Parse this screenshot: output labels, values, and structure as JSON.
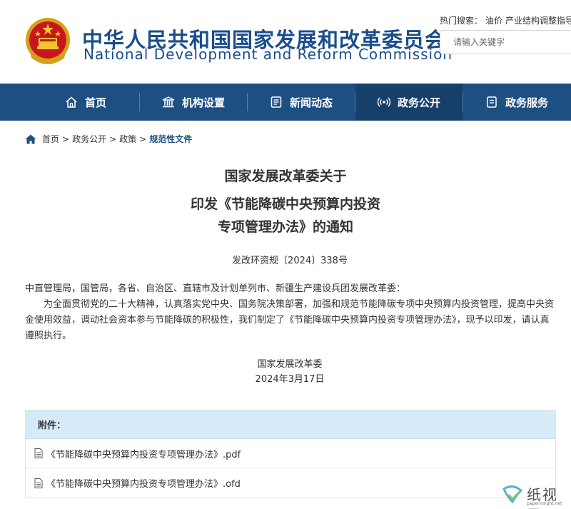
{
  "header": {
    "title_cn": "中华人民共和国国家发展和改革委员会",
    "title_en": "National Development and Reform Commission",
    "hot_search_label": "热门搜索：",
    "hot_search_items": [
      "油价",
      "产业结构调整指导"
    ],
    "search_placeholder": "请输入关键字"
  },
  "nav": {
    "items": [
      {
        "label": "首页",
        "icon": "home-icon"
      },
      {
        "label": "机构设置",
        "icon": "institution-icon"
      },
      {
        "label": "新闻动态",
        "icon": "news-icon"
      },
      {
        "label": "政务公开",
        "icon": "broadcast-icon",
        "active": true
      },
      {
        "label": "政务服务",
        "icon": "service-icon"
      }
    ]
  },
  "breadcrumb": {
    "items": [
      "首页",
      "政务公开",
      "政策"
    ],
    "separator": ">",
    "current": "规范性文件"
  },
  "article": {
    "title_lines": [
      "国家发展改革委关于",
      "印发《节能降碳中央预算内投资",
      "专项管理办法》的通知"
    ],
    "doc_number": "发改环资规〔2024〕338号",
    "recipients": "中直管理局，国管局，各省、自治区、直辖市及计划单列市、新疆生产建设兵团发展改革委：",
    "body": "为全面贯彻党的二十大精神，认真落实党中央、国务院决策部署，加强和规范节能降碳专项中央预算内投资管理，提高中央资金使用效益，调动社会资本参与节能降碳的积极性，我们制定了《节能降碳中央预算内投资专项管理办法》，现予以印发，请认真遵照执行。",
    "signature_org": "国家发展改革委",
    "signature_date": "2024年3月17日"
  },
  "attachments": {
    "header": "附件：",
    "files": [
      "《节能降碳中央预算内投资专项管理办法》.pdf",
      "《节能降碳中央预算内投资专项管理办法》.ofd"
    ]
  },
  "watermark": {
    "text": "纸视界",
    "sub": "paperinsight.net"
  },
  "colors": {
    "brand_blue": "#1d4f83",
    "nav_active": "#173f6c",
    "attachment_header_bg": "#d6ebf8"
  }
}
